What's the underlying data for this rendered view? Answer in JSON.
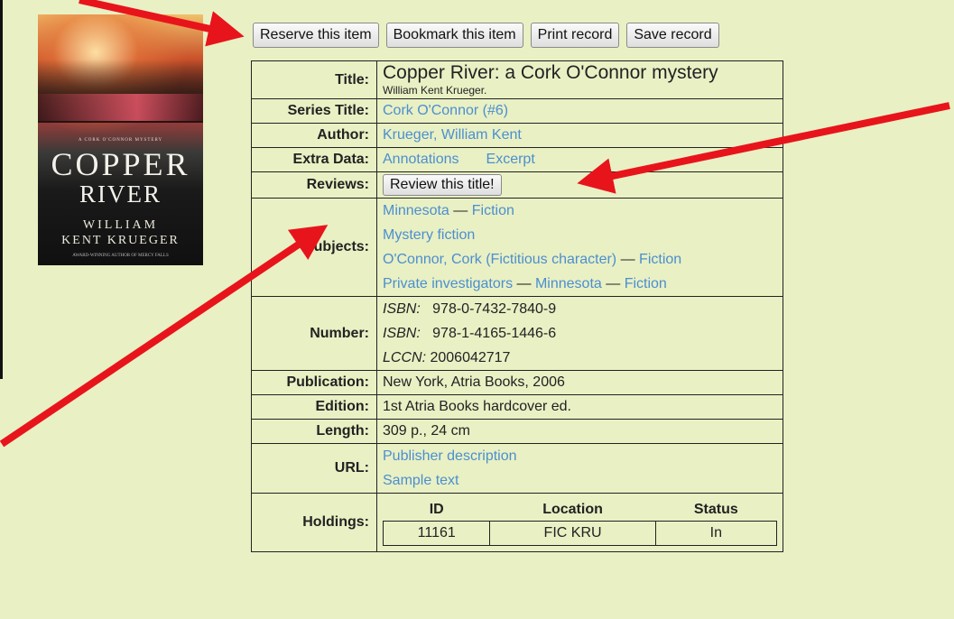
{
  "cover": {
    "series_line": "A CORK O'CONNOR MYSTERY",
    "title_line1": "COPPER",
    "title_line2": "RIVER",
    "author_line1": "WILLIAM",
    "author_line2": "KENT KRUEGER",
    "award_line": "AWARD-WINNING AUTHOR OF MERCY FALLS"
  },
  "toolbar": {
    "reserve": "Reserve this item",
    "bookmark": "Bookmark this item",
    "print": "Print record",
    "save": "Save record"
  },
  "labels": {
    "title": "Title:",
    "series": "Series Title:",
    "author": "Author:",
    "extra": "Extra Data:",
    "reviews": "Reviews:",
    "subjects": "Subjects:",
    "number": "Number:",
    "publication": "Publication:",
    "edition": "Edition:",
    "length": "Length:",
    "url": "URL:",
    "holdings": "Holdings:"
  },
  "record": {
    "title": "Copper River: a Cork O'Connor mystery",
    "responsibility": "William Kent Krueger.",
    "series": "Cork O'Connor (#6)",
    "author": "Krueger, William Kent",
    "extra": [
      "Annotations",
      "Excerpt"
    ],
    "review_button": "Review this title!",
    "subject_sep": "—",
    "subjects": [
      [
        "Minnesota",
        "Fiction"
      ],
      [
        "Mystery fiction"
      ],
      [
        "O'Connor, Cork (Fictitious character)",
        "Fiction"
      ],
      [
        "Private investigators",
        "Minnesota",
        "Fiction"
      ]
    ],
    "numbers": [
      {
        "type": "ISBN:",
        "value": "978-0-7432-7840-9"
      },
      {
        "type": "ISBN:",
        "value": "978-1-4165-1446-6"
      },
      {
        "type": "LCCN:",
        "value": "2006042717"
      }
    ],
    "publication": "New York, Atria Books, 2006",
    "edition": "1st Atria Books hardcover ed.",
    "length": "309 p., 24 cm",
    "urls": [
      "Publisher description",
      "Sample text"
    ],
    "holdings": {
      "headers": [
        "ID",
        "Location",
        "Status"
      ],
      "rows": [
        [
          "11161",
          "FIC KRU",
          "In"
        ]
      ]
    }
  },
  "annotation_color": "#e8141b"
}
